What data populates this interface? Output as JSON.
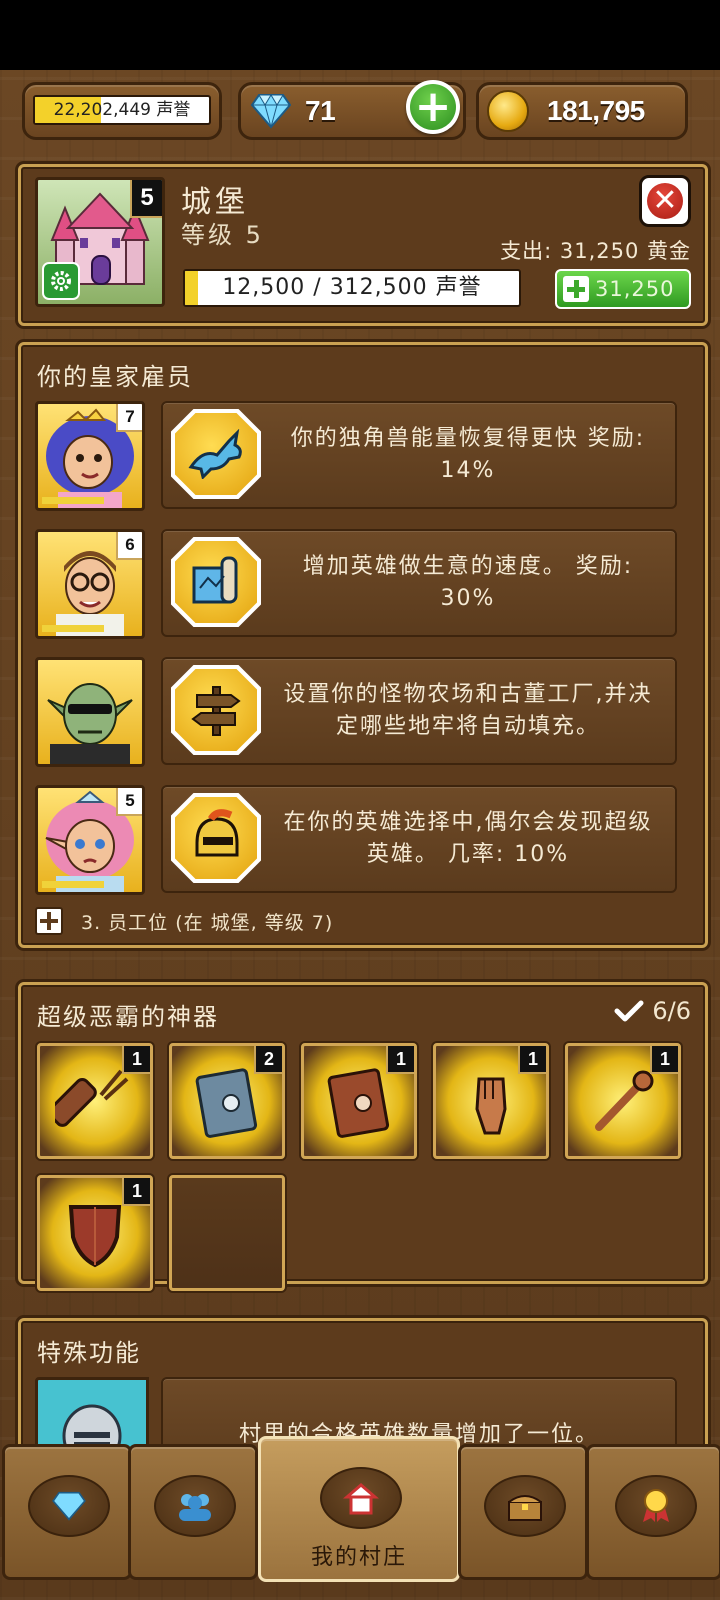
{
  "resources": {
    "fame_text": "22,202,449 声誉",
    "fame_progress": 0.38,
    "gems": "71",
    "gold": "181,795"
  },
  "building": {
    "name": "城堡",
    "level_text": "等级 5",
    "level_badge": "5",
    "cost_text": "支出: 31,250 黄金",
    "progress_text": "12,500 / 312,500 声誉",
    "progress_fraction": 0.04,
    "buy_value": "31,250"
  },
  "employees": {
    "title": "你的皇家雇员",
    "items": [
      {
        "level": "7",
        "icon": "unicorn-icon",
        "text": "你的独角兽能量恢复得更快 奖励: 14%"
      },
      {
        "level": "6",
        "icon": "map-scroll-icon",
        "text": "增加英雄做生意的速度。 奖励: 30%"
      },
      {
        "level": "",
        "icon": "signpost-icon",
        "text": "设置你的怪物农场和古董工厂,并决定哪些地牢将自动填充。"
      },
      {
        "level": "5",
        "icon": "knight-helmet-icon",
        "text": "在你的英雄选择中,偶尔会发现超级英雄。 几率: 10%"
      }
    ],
    "slot_text": "3. 员工位 (在 城堡, 等级 7)"
  },
  "artifacts": {
    "title": "超级恶霸的神器",
    "count": "6/6",
    "items": [
      {
        "icon": "quiver-icon",
        "badge": "1"
      },
      {
        "icon": "steel-book-icon",
        "badge": "2"
      },
      {
        "icon": "brown-book-icon",
        "badge": "1"
      },
      {
        "icon": "gauntlet-icon",
        "badge": "1"
      },
      {
        "icon": "mace-icon",
        "badge": "1"
      },
      {
        "icon": "shield-icon",
        "badge": "1"
      },
      {
        "icon": "empty-slot",
        "badge": ""
      }
    ]
  },
  "special": {
    "title": "特殊功能",
    "text": "村里的合格英雄数量增加了一位。"
  },
  "nav": {
    "active_label": "我的村庄",
    "tabs": [
      "diamond-icon",
      "people-icon",
      "house-icon",
      "treasure-chest-icon",
      "medal-icon"
    ]
  },
  "colors": {
    "wood": "#5d3b1c",
    "gold_border": "#caa152",
    "progress_yellow": "#f3d12a",
    "green": "#2f9a21"
  }
}
